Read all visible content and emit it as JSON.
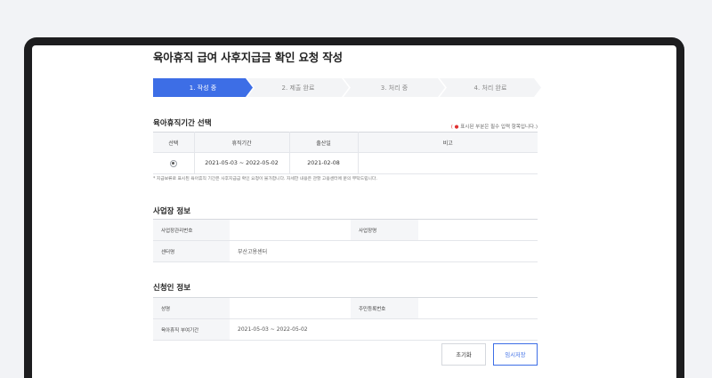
{
  "page": {
    "title": "육아휴직 급여 사후지급금 확인 요청 작성"
  },
  "steps": [
    "1. 작성 중",
    "2. 제출 완료",
    "3. 처리 중",
    "4. 처리 완료"
  ],
  "period_section": {
    "title": "육아휴직기간 선택",
    "required_note": "표시된 부분은 필수 입력 항목입니다.)",
    "required_mark": "( ●",
    "headers": [
      "선택",
      "휴직기간",
      "출산일",
      "비고"
    ],
    "row": {
      "period": "2021-05-03 ~ 2022-05-02",
      "birth_date": "2021-02-08",
      "note": ""
    },
    "notice": "* 지급보류로 표시된 육아휴직 기간은 사후지급금 확인 요청이 불가합니다. 자세한 내용은 관할 고용센터에 문의 부탁드립니다."
  },
  "business_section": {
    "title": "사업장 정보",
    "reg_no_label": "사업장관리번호",
    "reg_no_value": "",
    "name_label": "사업장명",
    "name_value": "",
    "center_label": "센터명",
    "center_value": "부산고용센터"
  },
  "applicant_section": {
    "title": "신청인 정보",
    "name_label": "성명",
    "name_value": "",
    "rrn_label": "주민등록번호",
    "rrn_value": "",
    "period_label": "육아휴직 부여기간",
    "period_value": "2021-05-03 ~ 2022-05-02"
  },
  "buttons": {
    "reset": "초기화",
    "save": "임시저장"
  },
  "colors": {
    "accent": "#3d6ee6",
    "device": "#1d1d1f",
    "background": "#f2f3f6"
  }
}
